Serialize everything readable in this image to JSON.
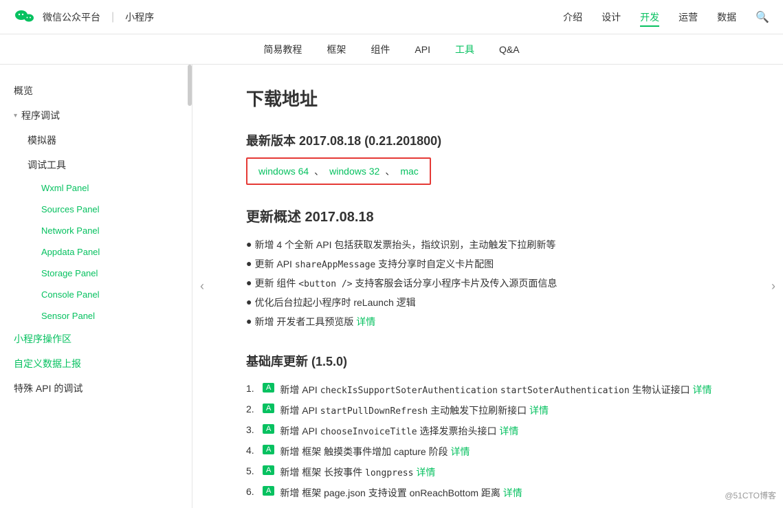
{
  "header": {
    "logo_alt": "WeChat",
    "site": "微信公众平台",
    "divider": "|",
    "product": "小程序",
    "nav_items": [
      {
        "label": "介绍",
        "active": false
      },
      {
        "label": "设计",
        "active": false
      },
      {
        "label": "开发",
        "active": true
      },
      {
        "label": "运营",
        "active": false
      },
      {
        "label": "数据",
        "active": false
      }
    ]
  },
  "sub_nav": {
    "items": [
      {
        "label": "简易教程",
        "active": false
      },
      {
        "label": "框架",
        "active": false
      },
      {
        "label": "组件",
        "active": false
      },
      {
        "label": "API",
        "active": false
      },
      {
        "label": "工具",
        "active": true
      },
      {
        "label": "Q&A",
        "active": false
      }
    ]
  },
  "sidebar": {
    "items": [
      {
        "label": "概览",
        "level": 0,
        "active": false
      },
      {
        "label": "程序调试",
        "level": 0,
        "group": true,
        "expanded": true
      },
      {
        "label": "模拟器",
        "level": 1,
        "active": false
      },
      {
        "label": "调试工具",
        "level": 1,
        "active": false,
        "group": true,
        "expanded": true
      },
      {
        "label": "Wxml Panel",
        "level": 2,
        "active": false
      },
      {
        "label": "Sources Panel",
        "level": 2,
        "active": true
      },
      {
        "label": "Network Panel",
        "level": 2,
        "active": false
      },
      {
        "label": "Appdata Panel",
        "level": 2,
        "active": false
      },
      {
        "label": "Storage Panel",
        "level": 2,
        "active": false
      },
      {
        "label": "Console Panel",
        "level": 2,
        "active": false
      },
      {
        "label": "Sensor Panel",
        "level": 2,
        "active": false
      },
      {
        "label": "小程序操作区",
        "level": 0,
        "active": false
      },
      {
        "label": "自定义数据上报",
        "level": 0,
        "active": false
      },
      {
        "label": "特殊 API 的调试",
        "level": 0,
        "active": false
      }
    ]
  },
  "main": {
    "page_title": "下载地址",
    "latest_version_label": "最新版本 2017.08.18 (0.21.201800)",
    "download_links": [
      {
        "label": "windows 64",
        "sep": "、"
      },
      {
        "label": "windows 32",
        "sep": "、"
      },
      {
        "label": "mac",
        "sep": ""
      }
    ],
    "update_section_title": "更新概述 2017.08.18",
    "update_items": [
      "新增 4 个全新 API 包括获取发票抬头，指纹识别，主动触发下拉刷新等",
      "更新 API shareAppMessage 支持分享时自定义卡片配图",
      "更新 组件 <button /> 支持客服会话分享小程序卡片及传入源页面信息",
      "优化后台拉起小程序时 reLaunch 逻辑",
      "新增 开发者工具预览版 详情"
    ],
    "update_items_detail_link_index": 4,
    "lib_section_title": "基础库更新 (1.5.0)",
    "lib_items": [
      {
        "num": "1.",
        "badge": "A",
        "text": "新增 API checkIsSupportSoterAuthentication startSoterAuthentication 生物认证接口",
        "detail": "详情"
      },
      {
        "num": "2.",
        "badge": "A",
        "text": "新增 API startPullDownRefresh 主动触发下拉刷新接口",
        "detail": "详情"
      },
      {
        "num": "3.",
        "badge": "A",
        "text": "新增 API chooseInvoiceTitle 选择发票抬头接口",
        "detail": "详情"
      },
      {
        "num": "4.",
        "badge": "A",
        "text": "新增 框架 触摸类事件增加 capture 阶段",
        "detail": "详情"
      },
      {
        "num": "5.",
        "badge": "A",
        "text": "新增 框架 长按事件 longpress",
        "detail": "详情"
      },
      {
        "num": "6.",
        "badge": "A",
        "text": "新增 框架 page.json 支持设置 onReachBottom 距离",
        "detail": "详情"
      }
    ]
  },
  "watermark": "@51CTO博客"
}
